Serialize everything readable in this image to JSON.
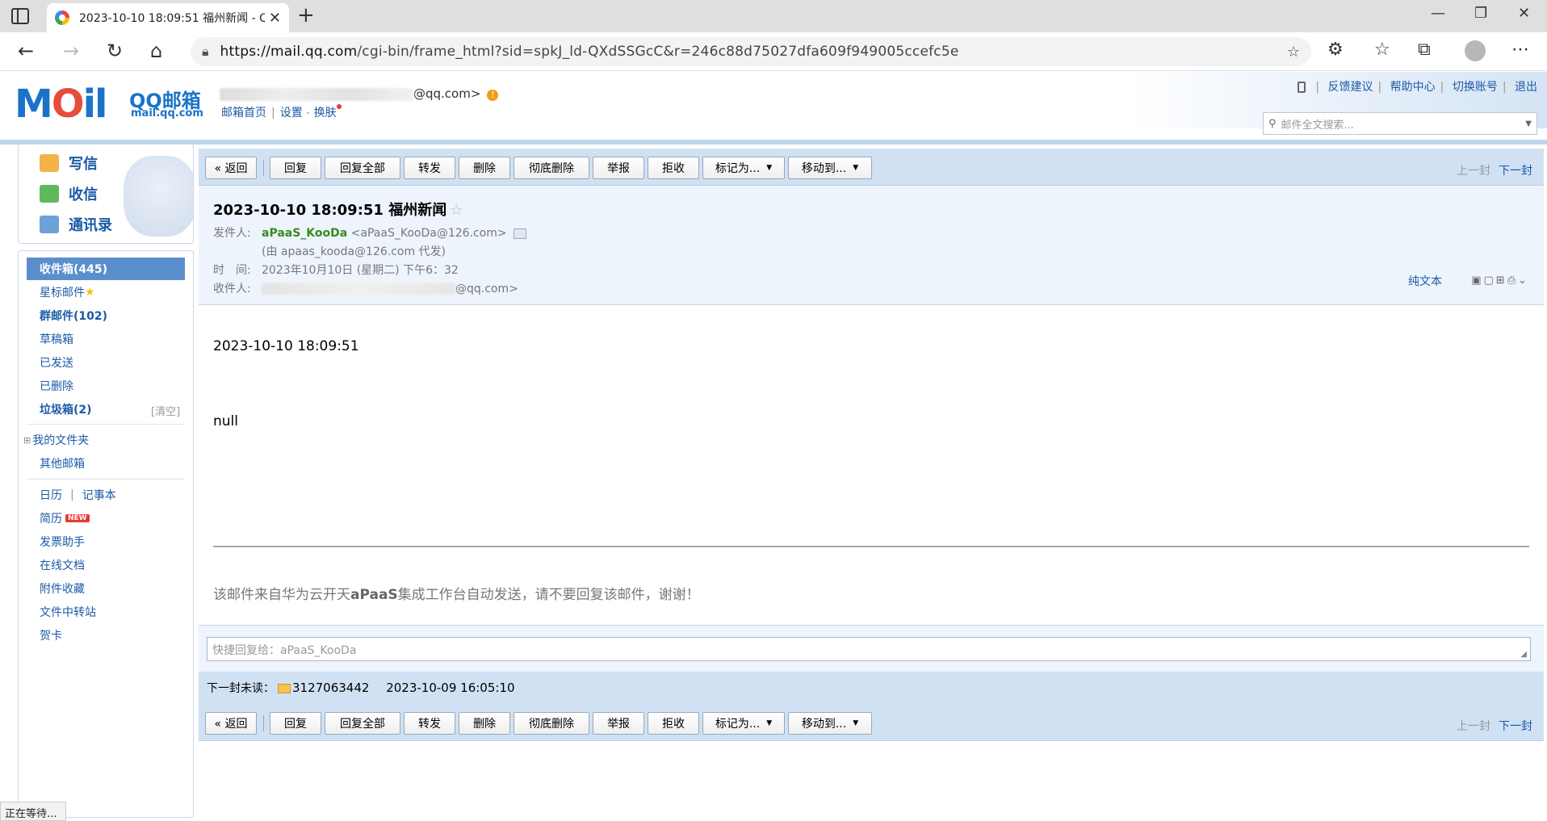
{
  "browser": {
    "tab_title": "2023-10-10 18:09:51 福州新闻 - Q",
    "url_host": "https://mail.qq.com",
    "url_path": "/cgi-bin/frame_html?sid=spkJ_ld-QXdSSGcC&r=246c88d75027dfa609f949005ccefc5e"
  },
  "header": {
    "account_suffix": "@qq.com>",
    "links": [
      "邮箱首页",
      "设置",
      "换肤"
    ],
    "top_right": [
      "反馈建议",
      "帮助中心",
      "切换账号",
      "退出"
    ],
    "search_placeholder": "邮件全文搜索...",
    "logo_qq": "QQ邮箱",
    "logo_site": "mail.qq.com"
  },
  "quick_actions": [
    "写信",
    "收信",
    "通讯录"
  ],
  "folders": {
    "inbox": "收件箱(445)",
    "starred": "星标邮件",
    "group": "群邮件(102)",
    "drafts": "草稿箱",
    "sent": "已发送",
    "deleted": "已删除",
    "junk": "垃圾箱(2)",
    "junk_clear": "[清空]",
    "my_folders": "我的文件夹",
    "other_mail": "其他邮箱",
    "calendar": "日历",
    "notes": "记事本",
    "resume": "简历",
    "new_badge": "NEW",
    "invoice": "发票助手",
    "docs": "在线文档",
    "attachments": "附件收藏",
    "transfer": "文件中转站",
    "cards": "贺卡"
  },
  "toolbar": {
    "back": "« 返回",
    "reply": "回复",
    "reply_all": "回复全部",
    "forward": "转发",
    "delete": "删除",
    "delete_forever": "彻底删除",
    "report": "举报",
    "reject": "拒收",
    "mark_as": "标记为...",
    "move_to": "移动到...",
    "prev": "上一封",
    "next": "下一封"
  },
  "mail": {
    "subject": "2023-10-10 18:09:51 福州新闻",
    "from_label": "发件人:",
    "from_name": "aPaaS_KooDa",
    "from_addr": "<aPaaS_KooDa@126.com>",
    "on_behalf": "(由 apaas_kooda@126.com 代发)",
    "time_label": "时　间:",
    "time_value": "2023年10月10日 (星期二) 下午6：32",
    "to_label": "收件人:",
    "to_suffix": "@qq.com>",
    "plain_text": "纯文本",
    "body_line1": "2023-10-10 18:09:51",
    "body_line2": "null",
    "footer_prefix": "该邮件来自华为云开天",
    "footer_bold": "aPaaS",
    "footer_suffix": "集成工作台自动发送，请不要回复该邮件，谢谢！"
  },
  "quick_reply_placeholder": "快捷回复给：aPaaS_KooDa",
  "next_unread": {
    "label": "下一封未读：",
    "sender": "3127063442",
    "time": "2023-10-09 16:05:10"
  },
  "status_bar": "正在等待..."
}
